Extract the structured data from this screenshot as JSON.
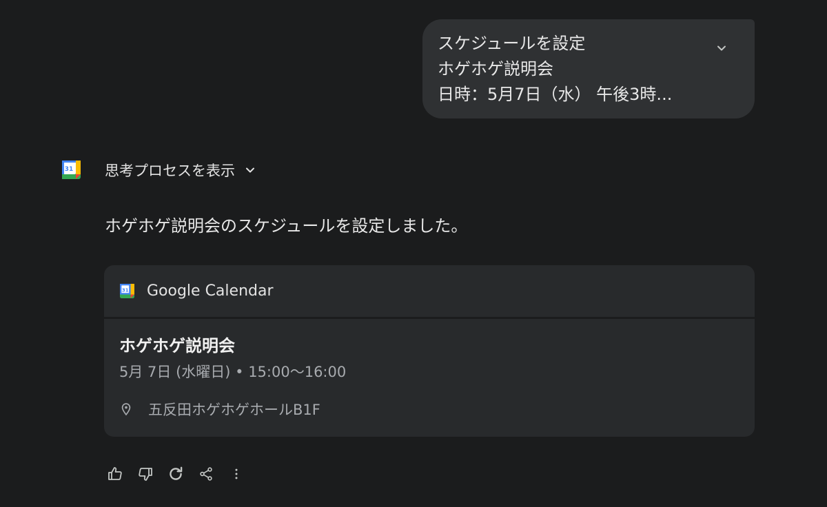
{
  "user_prompt": {
    "lines": [
      "スケジュールを設定",
      "ホゲホゲ説明会",
      "日時：5月7日（水） 午後3時..."
    ],
    "expand_icon": "chevron-down-icon"
  },
  "assistant": {
    "avatar_icon": "google-calendar-icon",
    "avatar_day": "31",
    "thinking_label": "思考プロセスを表示",
    "response": "ホゲホゲ説明会のスケジュールを設定しました。"
  },
  "calendar_card": {
    "app_name": "Google Calendar",
    "app_day": "31",
    "event": {
      "title": "ホゲホゲ説明会",
      "datetime": "5月 7日 (水曜日) • 15:00〜16:00",
      "location": "五反田ホゲホゲホールB1F"
    }
  },
  "actions": [
    {
      "icon": "thumbs-up-icon"
    },
    {
      "icon": "thumbs-down-icon"
    },
    {
      "icon": "regenerate-icon"
    },
    {
      "icon": "share-icon"
    },
    {
      "icon": "more-vert-icon"
    }
  ],
  "colors": {
    "background": "#1b1c1d",
    "bubble": "#2f3133",
    "card": "#282a2c",
    "text": "#e3e3e3",
    "muted": "#a8abaf"
  }
}
